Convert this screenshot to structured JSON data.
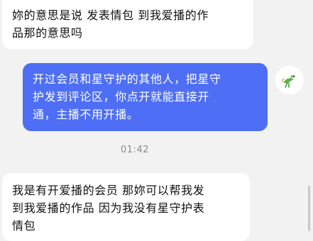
{
  "messages": [
    {
      "direction": "incoming",
      "lines": [
        "妳的意思是说 发表情包 到我爱播的作",
        "品那的意思吗"
      ]
    },
    {
      "direction": "outgoing",
      "lines": [
        "开过会员和星守护的其他人，把星守",
        "护发到评论区，你点开就能直接开",
        "通，主播不用开播。"
      ]
    },
    {
      "direction": "incoming",
      "lines": [
        "我是有开爱播的会员 那妳可以帮我发",
        "到我爱播的作品 因为我没有星守护表",
        "情包"
      ]
    }
  ],
  "timestamp": "01:42",
  "avatar_icon": "dragon-figure-icon",
  "colors": {
    "background": "#f2f2f2",
    "incoming_bubble": "#ffffff",
    "outgoing_bubble": "#4d6ef5",
    "avatar_accent": "#5bb04a"
  }
}
